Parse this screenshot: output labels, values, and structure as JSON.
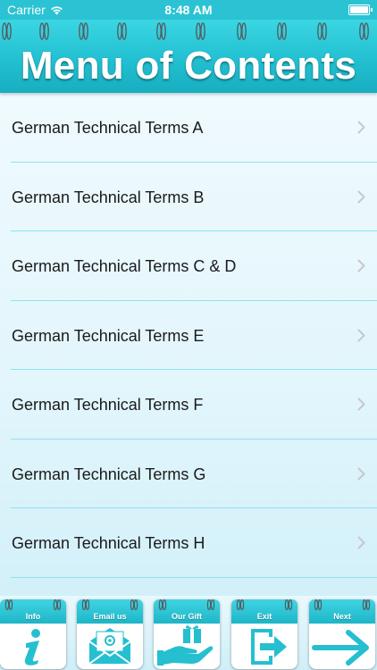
{
  "status_bar": {
    "carrier": "Carrier",
    "time": "8:48 AM",
    "icons": [
      "wifi-icon",
      "battery-icon"
    ]
  },
  "header": {
    "title": "Menu of Contents"
  },
  "menu": {
    "items": [
      {
        "label": "German Technical Terms A"
      },
      {
        "label": "German Technical Terms B"
      },
      {
        "label": "German Technical Terms C & D"
      },
      {
        "label": "German Technical Terms E"
      },
      {
        "label": "German Technical Terms F"
      },
      {
        "label": "German Technical Terms G"
      },
      {
        "label": "German Technical Terms H"
      }
    ],
    "item_icon": "chevron-right-icon"
  },
  "toolbar": {
    "info_label": "Info",
    "email_label": "Email us",
    "gift_label": "Our Gift",
    "exit_label": "Exit",
    "next_label": "Next",
    "icons": [
      "info-icon",
      "email-icon",
      "gift-icon",
      "exit-icon",
      "arrow-right-icon"
    ]
  },
  "colors": {
    "accent": "#22c0d1",
    "accent_dark": "#17aec0",
    "separator": "#8fe1ec",
    "chevron": "#c7c7cc",
    "icon_fill": "#25bfd0"
  }
}
